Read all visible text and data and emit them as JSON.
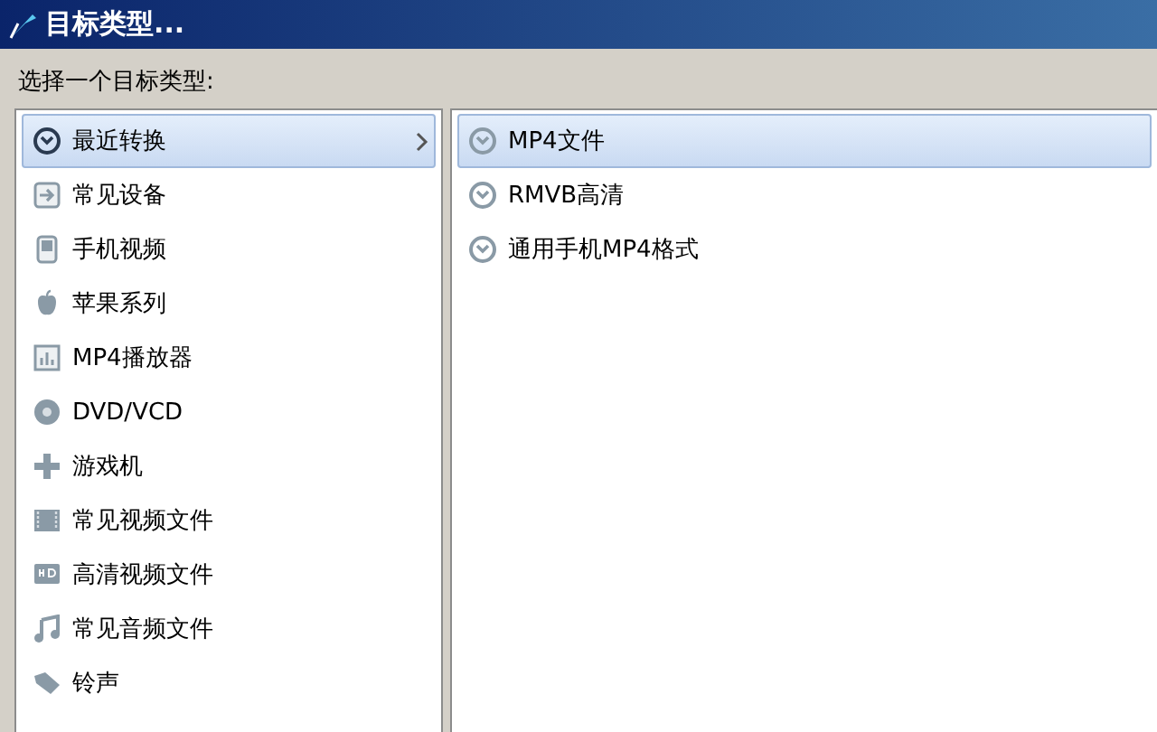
{
  "window": {
    "title": "目标类型..."
  },
  "prompt": "选择一个目标类型:",
  "categories": [
    {
      "label": "最近转换",
      "selected": true
    },
    {
      "label": "常见设备",
      "selected": false
    },
    {
      "label": "手机视频",
      "selected": false
    },
    {
      "label": "苹果系列",
      "selected": false
    },
    {
      "label": "MP4播放器",
      "selected": false
    },
    {
      "label": "DVD/VCD",
      "selected": false
    },
    {
      "label": "游戏机",
      "selected": false
    },
    {
      "label": "常见视频文件",
      "selected": false
    },
    {
      "label": "高清视频文件",
      "selected": false
    },
    {
      "label": "常见音频文件",
      "selected": false
    },
    {
      "label": "铃声",
      "selected": false
    }
  ],
  "formats": [
    {
      "label": "MP4文件",
      "selected": true
    },
    {
      "label": "RMVB高清",
      "selected": false
    },
    {
      "label": "通用手机MP4格式",
      "selected": false
    }
  ]
}
